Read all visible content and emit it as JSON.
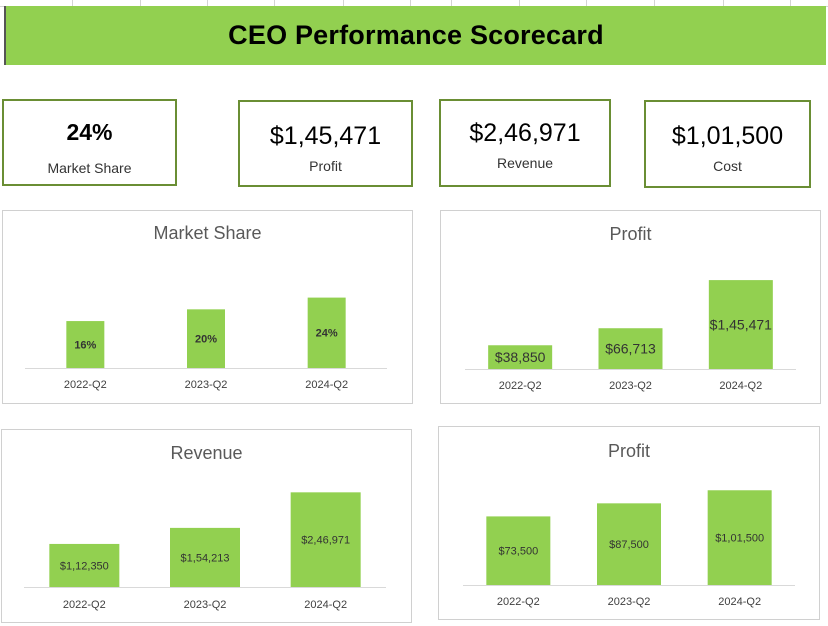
{
  "header": {
    "title": "CEO Performance Scorecard"
  },
  "kpis": [
    {
      "value": "24%",
      "label": "Market Share"
    },
    {
      "value": "$1,45,471",
      "label": "Profit"
    },
    {
      "value": "$2,46,971",
      "label": "Revenue"
    },
    {
      "value": "$1,01,500",
      "label": "Cost"
    }
  ],
  "colors": {
    "accent": "#92d050",
    "border": "#6a8e34"
  },
  "chart_data": [
    {
      "type": "bar",
      "title": "Market Share",
      "categories": [
        "2022-Q2",
        "2023-Q2",
        "2024-Q2"
      ],
      "values": [
        16,
        20,
        24
      ],
      "value_labels": [
        "16%",
        "20%",
        "24%"
      ],
      "ylim": [
        0,
        30
      ],
      "grid": false
    },
    {
      "type": "bar",
      "title": "Profit",
      "categories": [
        "2022-Q2",
        "2023-Q2",
        "2024-Q2"
      ],
      "values": [
        38850,
        66713,
        145471
      ],
      "value_labels": [
        "$38,850",
        "$66,713",
        "$1,45,471"
      ],
      "ylim": [
        0,
        180000
      ],
      "grid": false
    },
    {
      "type": "bar",
      "title": "Revenue",
      "categories": [
        "2022-Q2",
        "2023-Q2",
        "2024-Q2"
      ],
      "values": [
        112350,
        154213,
        246971
      ],
      "value_labels": [
        "$1,12,350",
        "$1,54,213",
        "$2,46,971"
      ],
      "ylim": [
        0,
        300000
      ],
      "grid": false
    },
    {
      "type": "bar",
      "title": "Profit",
      "categories": [
        "2022-Q2",
        "2023-Q2",
        "2024-Q2"
      ],
      "values": [
        73500,
        87500,
        101500
      ],
      "value_labels": [
        "$73,500",
        "$87,500",
        "$1,01,500"
      ],
      "ylim": [
        0,
        120000
      ],
      "grid": false
    }
  ]
}
